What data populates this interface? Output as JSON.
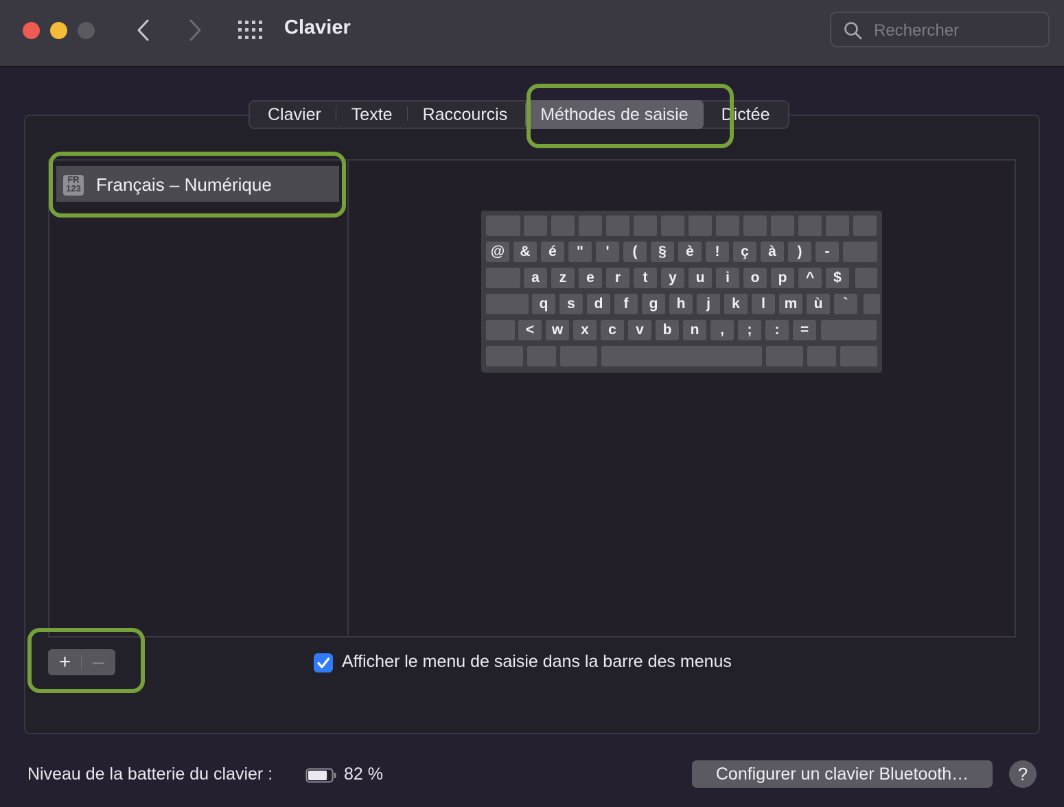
{
  "window": {
    "title": "Clavier",
    "search_placeholder": "Rechercher"
  },
  "tabs": [
    {
      "label": "Clavier",
      "selected": false
    },
    {
      "label": "Texte",
      "selected": false
    },
    {
      "label": "Raccourcis",
      "selected": false
    },
    {
      "label": "Méthodes de saisie",
      "selected": true
    },
    {
      "label": "Dictée",
      "selected": false
    }
  ],
  "input_sources": {
    "items": [
      {
        "label": "Français – Numérique",
        "icon_line1": "FR",
        "icon_line2": "123",
        "selected": true
      }
    ]
  },
  "keyboard_preview": {
    "rows": [
      [],
      [
        "@",
        "&",
        "é",
        "\"",
        "'",
        "(",
        "§",
        "è",
        "!",
        "ç",
        "à",
        ")",
        "-"
      ],
      [
        "a",
        "z",
        "e",
        "r",
        "t",
        "y",
        "u",
        "i",
        "o",
        "p",
        "^",
        "$"
      ],
      [
        "q",
        "s",
        "d",
        "f",
        "g",
        "h",
        "j",
        "k",
        "l",
        "m",
        "ù",
        "`"
      ],
      [
        "<",
        "w",
        "x",
        "c",
        "v",
        "b",
        "n",
        ",",
        ";",
        ":",
        "="
      ],
      []
    ]
  },
  "controls": {
    "add_symbol": "+",
    "remove_symbol": "–",
    "show_menu_checkbox": {
      "label": "Afficher le menu de saisie dans la barre des menus",
      "checked": true
    }
  },
  "footer": {
    "battery_label": "Niveau de la batterie du clavier :",
    "battery_value": "82 %",
    "battery_level": 0.82,
    "bluetooth_button": "Configurer un clavier Bluetooth…",
    "help_symbol": "?"
  },
  "colors": {
    "highlight": "#76a13a",
    "checkbox": "#2f7cf6"
  }
}
